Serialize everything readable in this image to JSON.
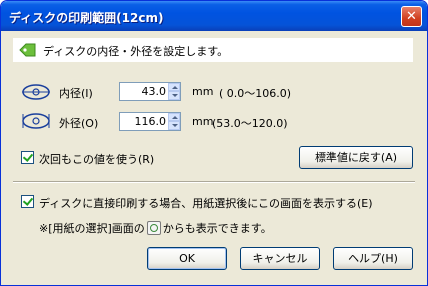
{
  "window": {
    "title": "ディスクの印刷範囲(12cm)",
    "close_label": "✕"
  },
  "info": {
    "text": "ディスクの内径・外径を設定します。"
  },
  "inner": {
    "label": "内径(I)",
    "value": "43.0",
    "unit": "mm",
    "range": "( 0.0～106.0)"
  },
  "outer": {
    "label": "外径(O)",
    "value": "116.0",
    "unit": "mm",
    "range": "(53.0～120.0)"
  },
  "reuse": {
    "label": "次回もこの値を使う(R)",
    "checked": true
  },
  "restore_button": "標準値に戻す(A)",
  "show_dialog": {
    "label": "ディスクに直接印刷する場合、用紙選択後にこの画面を表示する(E)",
    "checked": true
  },
  "note": {
    "prefix": "※[用紙の選択]画面の",
    "suffix": "からも表示できます。"
  },
  "buttons": {
    "ok": "OK",
    "cancel": "キャンセル",
    "help": "ヘルプ(H)"
  },
  "colors": {
    "titlebar": "#0053e1",
    "face": "#ece9d8",
    "accent_green": "#6cbf3c"
  }
}
